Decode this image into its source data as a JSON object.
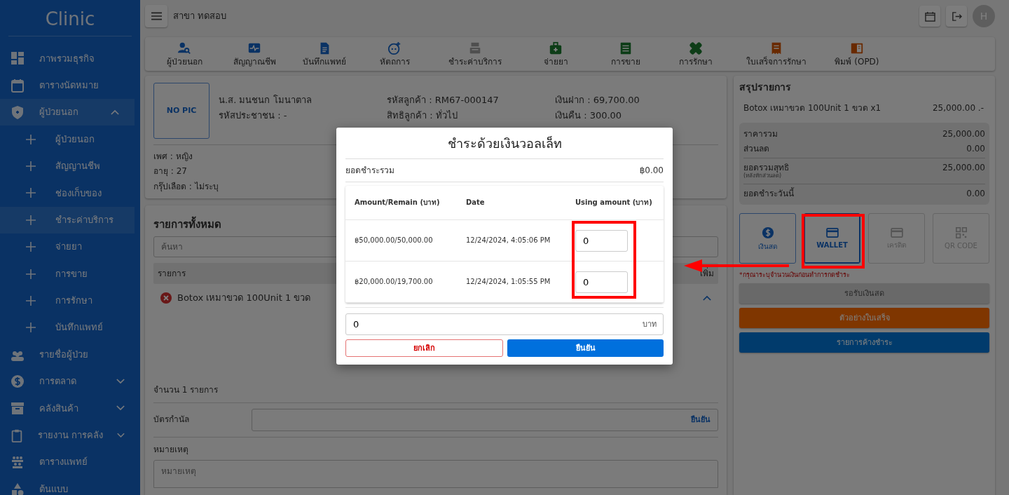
{
  "sidebar": {
    "logo": "Clinic",
    "items": [
      {
        "label": "ภาพรวมธุรกิจ",
        "selected": false
      },
      {
        "label": "ตารางนัดหมาย",
        "selected": false
      },
      {
        "label": "ผู้ป่วยนอก",
        "selected": true,
        "expanded": true,
        "children": [
          {
            "label": "ผู้ป่วยนอก",
            "selected": false
          },
          {
            "label": "สัญญานชีพ",
            "selected": false
          },
          {
            "label": "ช่องเก็บของ",
            "selected": false
          },
          {
            "label": "ชำระค่าบริการ",
            "selected": true
          },
          {
            "label": "จ่ายยา",
            "selected": false
          },
          {
            "label": "การขาย",
            "selected": false
          },
          {
            "label": "การรักษา",
            "selected": false
          },
          {
            "label": "บันทึกแพทย์",
            "selected": false
          }
        ]
      },
      {
        "label": "รายชื่อผู้ป่วย",
        "selected": false
      },
      {
        "label": "การตลาด",
        "selected": false,
        "expanded": false
      },
      {
        "label": "คลังสินค้า",
        "selected": false,
        "expanded": false
      },
      {
        "label": "รายงาน การคลัง",
        "selected": false,
        "expanded": false
      },
      {
        "label": "ตารางแพทย์",
        "selected": false
      },
      {
        "label": "ต้นแบบ",
        "selected": false
      }
    ]
  },
  "topbar": {
    "branch": "สาขา ทดสอบ",
    "avatar": "H"
  },
  "toolbar": [
    {
      "label": "ผู้ป่วยนอก"
    },
    {
      "label": "สัญญาณชีพ"
    },
    {
      "label": "บันทึกแพทย์"
    },
    {
      "label": "หัตถการ"
    },
    {
      "label": "ชำระค่าบริการ"
    },
    {
      "label": "จ่ายยา"
    },
    {
      "label": "การขาย"
    },
    {
      "label": "การรักษา"
    },
    {
      "label": "ใบเสร็จการรักษา"
    },
    {
      "label": "พิมพ์ (OPD)"
    }
  ],
  "patient": {
    "photo": "NO PIC",
    "fields": [
      "น.ส. มนชนก โมนาตาล",
      "รหัสลูกค้า : RM67-000147",
      "เงินฝาก : 69,700.00",
      "รหัสประชาชน : -",
      "สิทธิลูกค้า : ทั่วไป",
      "เงินคืน : 300.00"
    ],
    "details": [
      "เพศ : หญิง",
      "อายุ : 27",
      "กรุ๊ปเลือด : ไม่ระบุ"
    ]
  },
  "items": {
    "title": "รายการทั้งหมด",
    "search": {
      "placeholder": "ค้นหา"
    },
    "columns": [
      "รายการ",
      "เพิ่ม"
    ],
    "rows": [
      {
        "name": "Botox เหมาขวด 100Unit 1 ขวด",
        "expanded": true
      }
    ],
    "count": "จำนวน 1 รายการ",
    "voucher": {
      "label": "บัตรกำนัล",
      "button": "ยืนยัน"
    },
    "note": {
      "label": "หมายเหตุ",
      "placeholder": "หมายเหตุ"
    }
  },
  "summary": {
    "title": "สรุปรายการ",
    "lines": [
      {
        "name": "Botox เหมาขวด 100Unit 1 ขวด x1",
        "price": "25,000.00 .-"
      }
    ],
    "totals": [
      {
        "label": "ราคารวม",
        "value": "25,000.00"
      },
      {
        "label": "ส่วนลด",
        "value": "0.00"
      },
      {
        "label": "ยอดรวมสุทธิ",
        "sub": "(หลังหักส่วนลด)",
        "value": "25,000.00"
      },
      {
        "label": "ยอดชำระวันนี้",
        "value": "0.00"
      }
    ],
    "methods": [
      {
        "label": "เงินสด",
        "selected": false,
        "disabled": false
      },
      {
        "label": "WALLET",
        "selected": true,
        "disabled": false
      },
      {
        "label": "เครดิต",
        "selected": false,
        "disabled": true
      },
      {
        "label": "QR CODE",
        "selected": false,
        "disabled": true
      }
    ],
    "warning": "*กรุณาระบุจำนวนเงินก่อนทำการกดชำระ",
    "buttons": [
      {
        "label": "รอรับเงินสด",
        "kind": "disabled"
      },
      {
        "label": "ตัวอย่างใบเสร็จ",
        "kind": "orange"
      },
      {
        "label": "รายการค้างชำระ",
        "kind": "blue"
      }
    ]
  },
  "modal": {
    "title": "ชำระด้วยเงินวอลเล็ท",
    "total_label": "ยอดชำระรวม",
    "total": "฿0.00",
    "columns": [
      "Amount/Remain (บาท)",
      "Date",
      "Using amount (บาท)"
    ],
    "rows": [
      {
        "amount": "฿50,000.00/50,000.00",
        "date": "12/24/2024, 4:05:06 PM",
        "using": "0"
      },
      {
        "amount": "฿20,000.00/19,700.00",
        "date": "12/24/2024, 1:05:55 PM",
        "using": "0"
      }
    ],
    "amount": "0",
    "unit": "บาท",
    "cancel": "ยกเลิก",
    "confirm": "ยืนยัน"
  }
}
